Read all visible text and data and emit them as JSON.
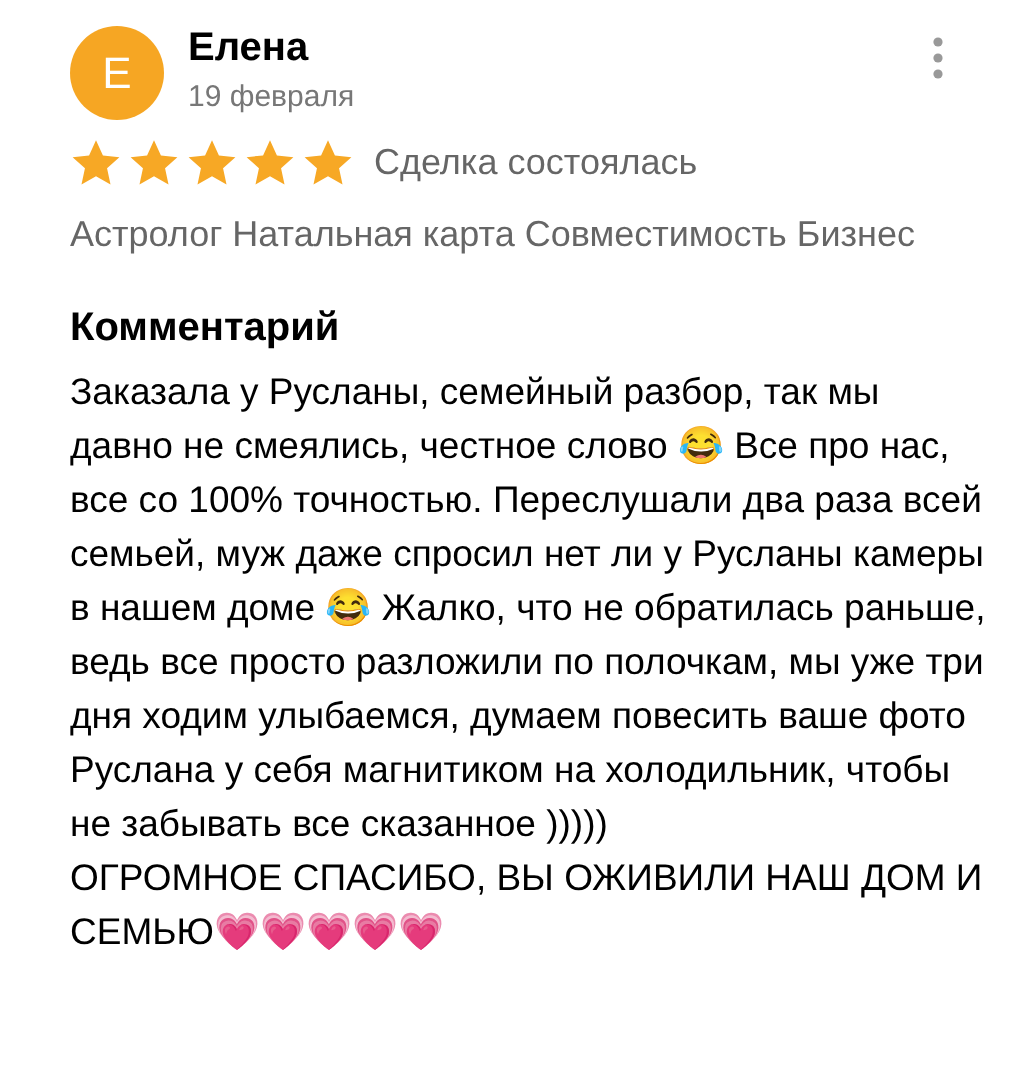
{
  "review": {
    "author": "Елена",
    "avatar_letter": "E",
    "date": "19 февраля",
    "stars": 5,
    "status": "Сделка состоялась",
    "tags": "Астролог Натальная карта Совместимость Бизнес",
    "comment_heading": "Комментарий",
    "comment": "Заказала у Русланы, семейный разбор, так мы давно не смеялись, честное слово 😂 Все про нас, все со 100% точностью. Переслушали два раза всей семьей, муж даже спросил нет ли у Русланы камеры в нашем доме 😂 Жалко, что не обратилась раньше, ведь все просто разложили по полочкам, мы  уже три дня ходим улыбаемся, думаем повесить ваше фото Руслана у себя магнитиком на холодильник, чтобы не забывать все сказанное )))))\nОГРОМНОЕ СПАСИБО, ВЫ  ОЖИВИЛИ НАШ ДОМ И СЕМЬЮ💗💗💗💗💗"
  }
}
